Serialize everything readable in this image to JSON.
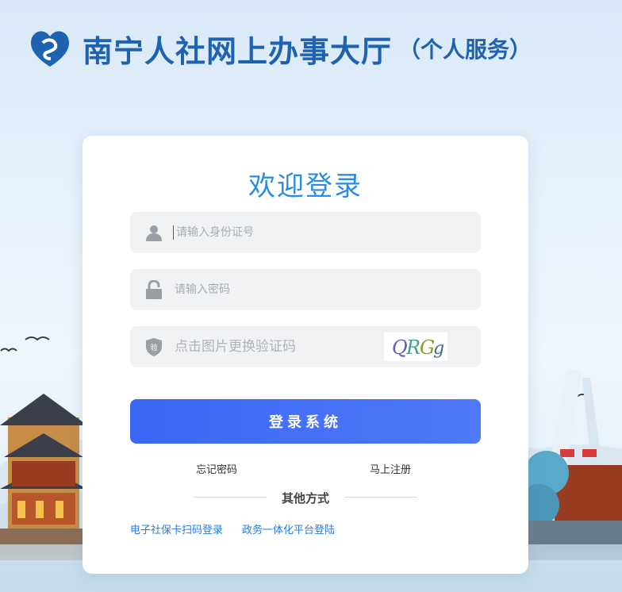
{
  "header": {
    "title": "南宁人社网上办事大厅",
    "subtitle": "（个人服务）",
    "logo_icon": "heart-logo-icon"
  },
  "login": {
    "title": "欢迎登录",
    "id_placeholder": "请输入身份证号",
    "password_placeholder": "请输入密码",
    "captcha_placeholder": "点击图片更换验证码",
    "captcha_text": "QRCg",
    "captcha_icon_label": "验",
    "submit_label": "登录系统",
    "forgot_label": "忘记密码",
    "register_label": "马上注册",
    "other_methods_label": "其他方式",
    "alt_login_1": "电子社保卡扫码登录",
    "alt_login_2": "政务一体化平台登陆"
  },
  "colors": {
    "brand_blue": "#1f63b0",
    "accent_blue": "#2a8ce6",
    "button_blue": "#3b66f5"
  },
  "icons": [
    "user-icon",
    "lock-icon",
    "shield-icon"
  ]
}
